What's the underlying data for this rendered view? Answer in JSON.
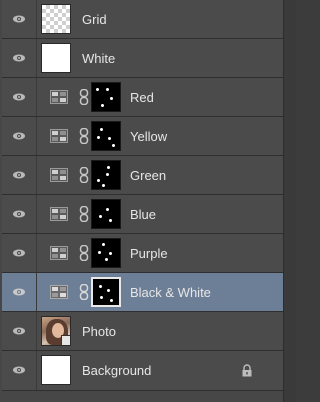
{
  "panel": {
    "name": "layers"
  },
  "layers": [
    {
      "label": "Grid",
      "thumb": "checker",
      "visible": true
    },
    {
      "label": "White",
      "thumb": "white-soft",
      "visible": true
    },
    {
      "label": "Red",
      "thumb": "adjustment-mask",
      "visible": true
    },
    {
      "label": "Yellow",
      "thumb": "adjustment-mask",
      "visible": true
    },
    {
      "label": "Green",
      "thumb": "adjustment-mask",
      "visible": true
    },
    {
      "label": "Blue",
      "thumb": "adjustment-mask",
      "visible": true
    },
    {
      "label": "Purple",
      "thumb": "adjustment-mask",
      "visible": true
    },
    {
      "label": "Black & White",
      "thumb": "adjustment-mask",
      "visible": true,
      "selected": true
    },
    {
      "label": "Photo",
      "thumb": "photo",
      "visible": true
    },
    {
      "label": "Background",
      "thumb": "white",
      "visible": true,
      "locked": true
    }
  ],
  "icons": {
    "visibility": "eye-icon",
    "adjustment": "channel-mixer-icon",
    "link": "chain-link-icon",
    "lock": "lock-icon"
  },
  "colors": {
    "selected_row": "#6d7f96",
    "row": "#4b4b4b",
    "text": "#e6e6e6"
  }
}
